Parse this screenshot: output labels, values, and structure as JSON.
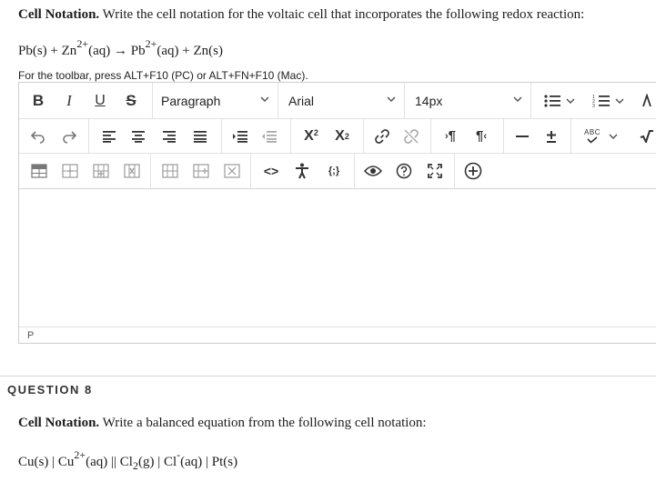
{
  "question7": {
    "heading": "Cell Notation.",
    "prompt": "Write the cell notation for the voltaic cell that incorporates the following redox reaction:",
    "reaction": {
      "r1": "Pb(s)",
      "plus": "+",
      "r2_base": "Zn",
      "r2_charge": "2+",
      "r2_state": "(aq)",
      "arrow": "→",
      "p1_base": "Pb",
      "p1_charge": "2+",
      "p1_state": "(aq)",
      "p2": "Zn(s)"
    },
    "hint": "For the toolbar, press ALT+F10 (PC) or ALT+FN+F10 (Mac)."
  },
  "editor": {
    "toolbar": {
      "bold": "B",
      "italic": "I",
      "underline": "U",
      "strike": "S",
      "block_format": "Paragraph",
      "font_family": "Arial",
      "font_size": "14px",
      "superscript": "X",
      "superscript_mark": "2",
      "subscript": "X",
      "subscript_mark": "2",
      "spellcheck_abc": "ABC",
      "ltr": "¶",
      "rtl": "¶",
      "code": "<>",
      "template": "{;}"
    },
    "body_text": "",
    "path": "P"
  },
  "question8": {
    "label": "QUESTION 8",
    "heading": "Cell Notation.",
    "prompt": "Write a balanced equation from the following cell notation:",
    "notation": {
      "a": "Cu(s) | Cu",
      "a_charge": "2+",
      "b": "(aq) || Cl",
      "b_sub": "2",
      "c": "(g) | Cl",
      "c_charge": "-",
      "d": "(aq) | Pt(s)"
    }
  },
  "colors": {
    "icon": "#333333",
    "border": "#cfcfcf",
    "divider": "#e2e2e2"
  }
}
